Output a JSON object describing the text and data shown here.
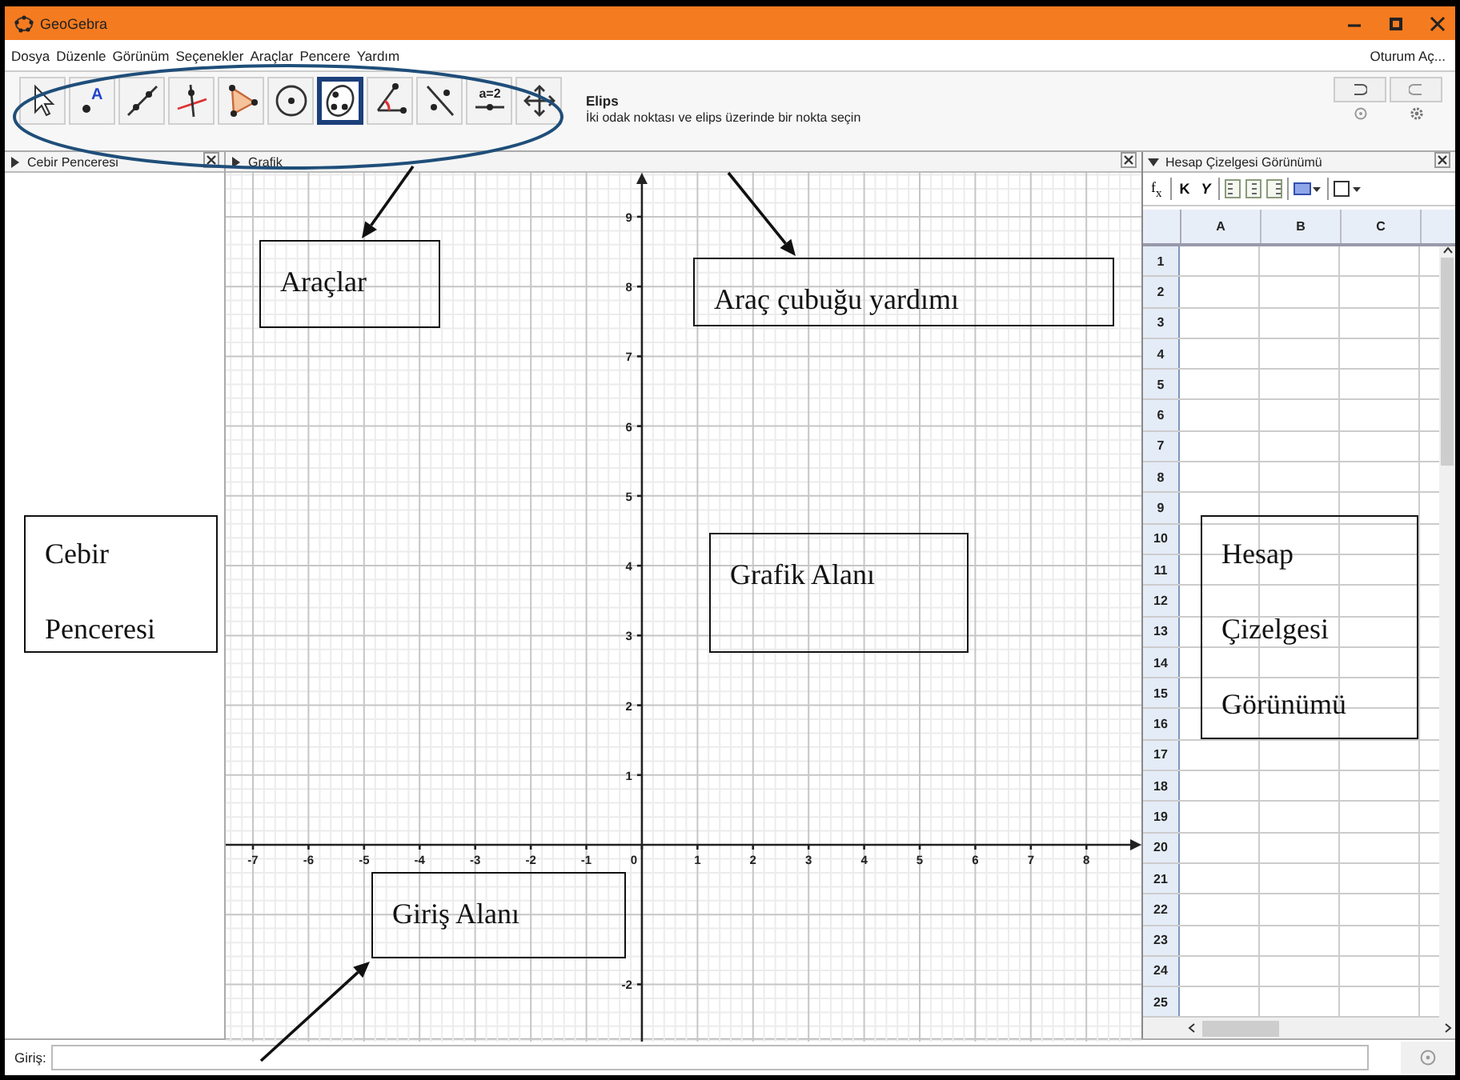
{
  "window": {
    "title": "GeoGebra"
  },
  "menu": [
    "Dosya",
    "Düzenle",
    "Görünüm",
    "Seçenekler",
    "Araçlar",
    "Pencere",
    "Yardım"
  ],
  "sign_in": "Oturum Aç...",
  "tools": [
    {
      "kind": "move",
      "selected": false
    },
    {
      "kind": "point",
      "label": "A",
      "selected": false
    },
    {
      "kind": "line",
      "selected": false
    },
    {
      "kind": "perpendicular",
      "selected": false
    },
    {
      "kind": "polygon",
      "selected": false
    },
    {
      "kind": "circle",
      "selected": false
    },
    {
      "kind": "ellipse",
      "selected": true
    },
    {
      "kind": "angle",
      "selected": false
    },
    {
      "kind": "reflect",
      "selected": false
    },
    {
      "kind": "slider",
      "label": "a=2",
      "selected": false
    },
    {
      "kind": "pan",
      "selected": false
    }
  ],
  "tool_help": {
    "name": "Elips",
    "description": "İki odak noktası ve elips üzerinde bir nokta seçin"
  },
  "algebra_view": {
    "title": "Cebir Penceresi",
    "style_bar_expanded": false
  },
  "graphics_view": {
    "title": "Grafik",
    "style_bar_expanded": false,
    "chart_data": {
      "type": "scatter",
      "grid": true,
      "xlim": [
        -7.49,
        8.99
      ],
      "ylim": [
        -2.82,
        9.63
      ],
      "xticks": [
        -7,
        -6,
        -5,
        -4,
        -3,
        -2,
        -1,
        0,
        1,
        2,
        3,
        4,
        5,
        6,
        7,
        8
      ],
      "yticks": [
        -2,
        1,
        2,
        3,
        4,
        5,
        6,
        7,
        8,
        9
      ]
    }
  },
  "spreadsheet_view": {
    "title": "Hesap Çizelgesi Görünümü",
    "style_bar_expanded": true,
    "formula_button": "f$_{x}$",
    "style_buttons": [
      {
        "kind": "bold",
        "label": "K"
      },
      {
        "kind": "italic",
        "label": "Y"
      }
    ],
    "columns": [
      "A",
      "B",
      "C"
    ],
    "rows": [
      "1",
      "2",
      "3",
      "4",
      "5",
      "6",
      "7",
      "8",
      "9",
      "10",
      "11",
      "12",
      "13",
      "14",
      "15",
      "16",
      "17",
      "18",
      "19",
      "20",
      "21",
      "22",
      "23",
      "24",
      "25"
    ]
  },
  "input_bar": {
    "label": "Giriş:"
  },
  "annotations": [
    {
      "text": "Araçlar"
    },
    {
      "text": "Araç çubuğu yardımı"
    },
    {
      "text": "Cebir Penceresi"
    },
    {
      "text": "Grafik Alanı"
    },
    {
      "text": "Giriş Alanı"
    },
    {
      "text": "Hesap Çizelgesi Görünümü"
    }
  ]
}
